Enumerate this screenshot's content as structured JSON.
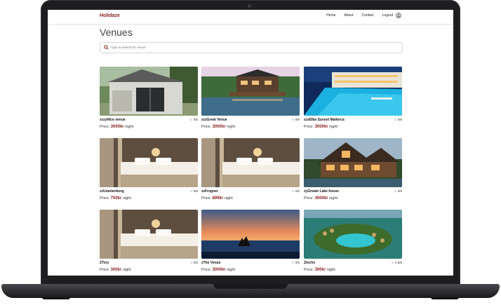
{
  "app": {
    "brand": "Holidaze",
    "nav": [
      "Home",
      "About",
      "Contact",
      "Logout"
    ],
    "page_title": "Venues",
    "search_placeholder": "Type to search for venue"
  },
  "venues": [
    {
      "name": "zzzyNice venue",
      "rating": "0/5",
      "price_label": "Price:",
      "amount": "3000kr",
      "unit": "night",
      "image": "tiny-house"
    },
    {
      "name": "zzzGreat Venue",
      "rating": "0/5",
      "price_label": "Price:",
      "amount": "3000kr",
      "unit": "night",
      "image": "lake-cabin"
    },
    {
      "name": "zzzElba Sunset Mallorca",
      "rating": "0/5",
      "price_label": "Price:",
      "amount": "3000kr",
      "unit": "night",
      "image": "pool-resort"
    },
    {
      "name": "zzUranienborg",
      "rating": "0/5",
      "price_label": "Price:",
      "amount": "750kr",
      "unit": "night",
      "image": "hotel-room"
    },
    {
      "name": "zzFrogner",
      "rating": "0/5",
      "price_label": "Price:",
      "amount": "899kr",
      "unit": "night",
      "image": "hotel-room"
    },
    {
      "name": "zyGreate Lake house",
      "rating": "0/5",
      "price_label": "Price:",
      "amount": "3000kr",
      "unit": "night",
      "image": "lake-house"
    },
    {
      "name": "ZTorz",
      "rating": "0/5",
      "price_label": "Price:",
      "amount": "300kr",
      "unit": "night",
      "image": "hotel-room"
    },
    {
      "name": "zThe Venue",
      "rating": "0/5",
      "price_label": "Price:",
      "amount": "3000kr",
      "unit": "night",
      "image": "sunset-sea"
    },
    {
      "name": "Ztechs",
      "rating": "4.5/5",
      "price_label": "Price:",
      "amount": "300kr",
      "unit": "night",
      "image": "island-resort"
    }
  ],
  "colors": {
    "brand": "#8a1c1c",
    "accent": "#c0392b"
  }
}
